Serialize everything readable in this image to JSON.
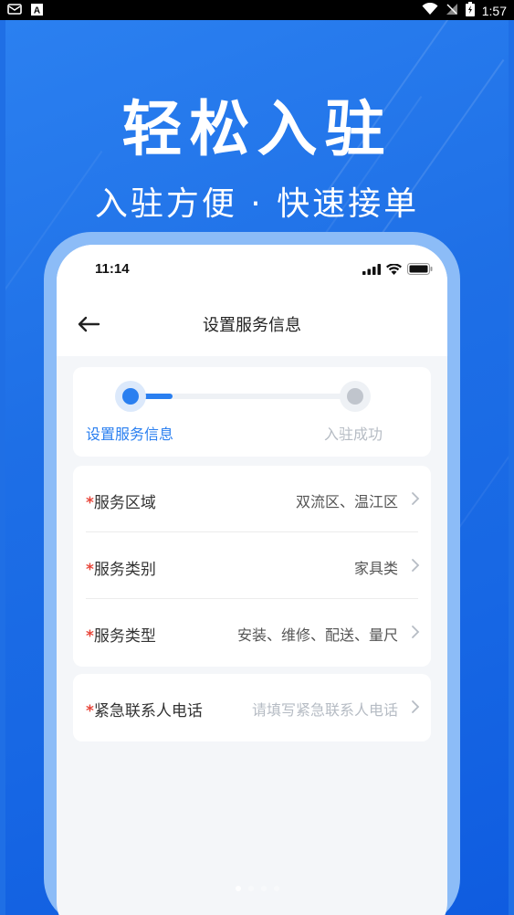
{
  "status_bar": {
    "time": "1:57",
    "left_icons": [
      "mail-icon",
      "a-badge-icon"
    ],
    "right_icons": [
      "wifi-icon",
      "no-signal-icon",
      "battery-charging-icon"
    ]
  },
  "promo": {
    "headline": "轻松入驻",
    "subline": "入驻方便 · 快速接单"
  },
  "phone": {
    "ios_time": "11:14",
    "ios_icons": [
      "cellular-icon",
      "wifi-icon",
      "battery-icon"
    ],
    "nav": {
      "back_icon": "arrow-left-icon",
      "title": "设置服务信息"
    },
    "steps": [
      {
        "label": "设置服务信息",
        "active": true
      },
      {
        "label": "入驻成功",
        "active": false
      }
    ],
    "step_progress": 0.18,
    "form": {
      "rows": [
        {
          "label": "服务区域",
          "value": "双流区、温江区",
          "required_mark": "*"
        },
        {
          "label": "服务类别",
          "value": "家具类",
          "required_mark": "*"
        },
        {
          "label": "服务类型",
          "value": "安装、维修、配送、量尺",
          "required_mark": "*"
        }
      ],
      "contact": {
        "label": "紧急联系人电话",
        "placeholder": "请填写紧急联系人电话",
        "required_mark": "*"
      }
    }
  },
  "pager": {
    "count": 4,
    "active_index": 0
  },
  "colors": {
    "brand_blue": "#1f6fe5",
    "step_active": "#2a7ff0",
    "step_inactive": "#c0c5cd",
    "required": "#e8463a"
  }
}
